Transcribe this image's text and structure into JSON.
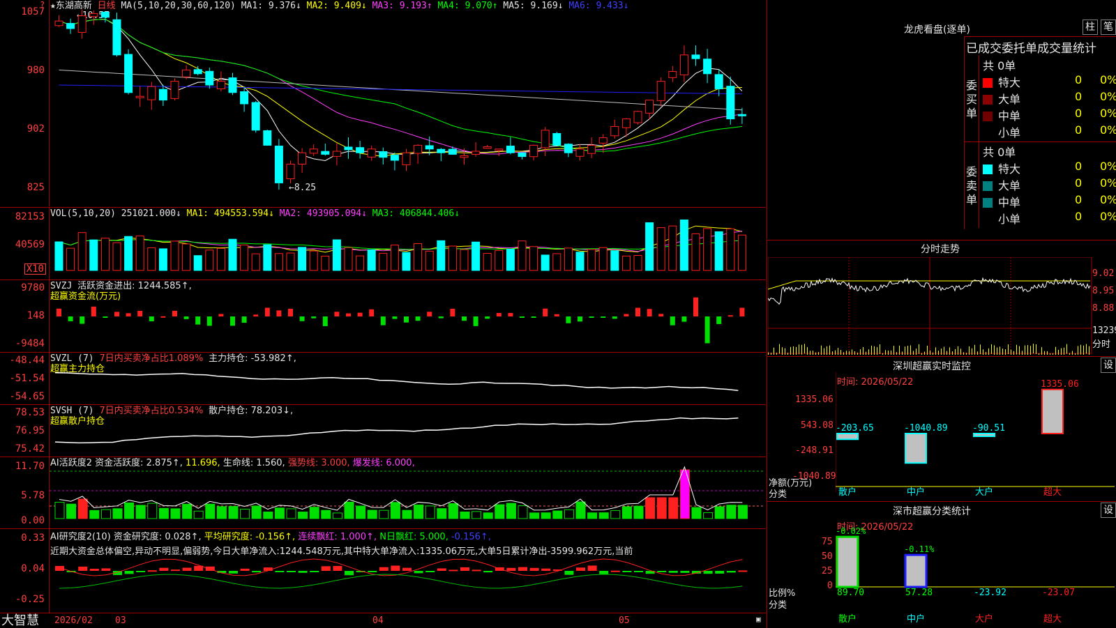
{
  "stock": {
    "name": "东湖高新",
    "period": "日线",
    "ma_header": "MA(5,10,20,30,60,120)",
    "ma1": "MA1: 9.376↓",
    "ma2": "MA2: 9.409↓",
    "ma3": "MA3: 9.193↑",
    "ma4": "MA4: 9.070↑",
    "ma5": "MA5: 9.169↓",
    "ma6": "MA6: 9.433↓",
    "high_mark": "10.57",
    "low_mark": "8.25",
    "y_labels": [
      "1057",
      "980",
      "902",
      "825"
    ]
  },
  "vol": {
    "header": "VOL(5,10,20)",
    "value": "251021.000↓",
    "ma1": "MA1: 494553.594↓",
    "ma2": "MA2: 493905.094↓",
    "ma3": "MA3: 406844.406↓",
    "y_labels": [
      "82153",
      "40569"
    ],
    "unit": "X10"
  },
  "svzj": {
    "header": "SVZJ",
    "active": "活跃资金进出: 1244.585↑,",
    "sub": "超赢资金流(万元)",
    "y_labels": [
      "9780",
      "148",
      "-9484"
    ]
  },
  "svzl": {
    "header": "SVZL (7)",
    "ratio": "7日内买卖净占比1.089%",
    "hold": "主力持仓: -53.982↑,",
    "sub": "超赢主力持仓",
    "y_labels": [
      "-48.44",
      "-51.54",
      "-54.65"
    ]
  },
  "svsh": {
    "header": "SVSH (7)",
    "ratio": "7日内买卖净占比0.534%",
    "hold": "散户持仓: 78.203↓,",
    "sub": "超赢散户持仓",
    "y_labels": [
      "78.53",
      "76.95",
      "75.42"
    ]
  },
  "ai_active": {
    "header": "AI活跃度2",
    "a": "资金活跃度: 2.875↑,",
    "b": "11.696,",
    "c": "生命线: 1.560,",
    "d": "强势线: 3.000,",
    "e": "爆发线: 6.000,",
    "y_labels": [
      "11.70",
      "5.78",
      "0.00"
    ]
  },
  "ai_research": {
    "header": "AI研究度2(10)",
    "a": "资金研究度: 0.028↑,",
    "b": "平均研究度: -0.156↑,",
    "c": "连续飘红: 1.000↑,",
    "d": "N日飘红: 5.000,",
    "e": "-0.156↑,",
    "comment": "近期大资金总体偏空,异动不明显,偏弱势,今日大单净流入:1244.548万元,其中特大单净流入:1335.06万元,大单5日累计净出-3599.962万元,当前",
    "y_labels": [
      "0.33",
      "0.04",
      "-0.25"
    ]
  },
  "bottom": {
    "brand": "大智慧",
    "dates": [
      "2026/02",
      "03",
      "04",
      "05"
    ]
  },
  "dragon": {
    "title": "龙虎看盘(逐单)",
    "btn1": "柱",
    "btn2": "笔",
    "subtitle": "已成交委托单成交量统计",
    "buy_label": "委买单",
    "sell_label": "委卖单",
    "buy_total": "共 0单",
    "sell_total": "共 0单",
    "buy_rows": [
      {
        "label": "特大",
        "count": "0",
        "pct": "0%",
        "color": "#ff0000"
      },
      {
        "label": "大单",
        "count": "0",
        "pct": "0%",
        "color": "#8b0000"
      },
      {
        "label": "中单",
        "count": "0",
        "pct": "0%",
        "color": "#700000"
      },
      {
        "label": "小单",
        "count": "0",
        "pct": "0%",
        "color": ""
      }
    ],
    "sell_rows": [
      {
        "label": "特大",
        "count": "0",
        "pct": "0%",
        "color": "#00ffff"
      },
      {
        "label": "大单",
        "count": "0",
        "pct": "0%",
        "color": "#008080"
      },
      {
        "label": "中单",
        "count": "0",
        "pct": "0%",
        "color": "#008080"
      },
      {
        "label": "小单",
        "count": "0",
        "pct": "0%",
        "color": ""
      }
    ]
  },
  "intraday": {
    "title": "分时走势",
    "y_labels": [
      "9.02",
      "8.95",
      "8.88"
    ],
    "vol_label": "13239",
    "vol_unit": "分时"
  },
  "sz_monitor": {
    "title": "深圳超赢实时监控",
    "btn": "设",
    "date": "时间: 2026/05/22",
    "y_labels": [
      "1335.06",
      "543.08",
      "-248.91",
      "-1040.89"
    ],
    "axis_title": "净额(万元)",
    "axis_sub": "分类",
    "chart_data": {
      "type": "bar",
      "categories": [
        "散户",
        "中户",
        "大户",
        "超大"
      ],
      "values": [
        -203.65,
        -1040.89,
        -90.51,
        1335.06
      ],
      "value_labels": [
        "-203.65",
        "-1040.89",
        "-90.51",
        "1335.06"
      ],
      "ylim": [
        -1040.89,
        1335.06
      ]
    }
  },
  "sz_class": {
    "title": "深市超赢分类统计",
    "btn": "设",
    "date": "时间: 2026/05/22",
    "y_labels": [
      "75",
      "50",
      "25",
      "0"
    ],
    "axis_title": "比例%",
    "axis_sub": "分类",
    "chart_data": {
      "type": "bar",
      "categories": [
        "散户",
        "中户",
        "大户",
        "超大"
      ],
      "values": [
        89.7,
        57.28,
        -23.92,
        -23.07
      ],
      "change_labels": [
        "-0.02%",
        "-0.11%",
        "",
        ""
      ],
      "value_labels": [
        "89.70",
        "57.28",
        "-23.92",
        "-23.07"
      ],
      "ylim": [
        0,
        90
      ]
    }
  },
  "colors": {
    "up": "#ff2020",
    "down": "#00ffff",
    "frame": "#a00000"
  }
}
